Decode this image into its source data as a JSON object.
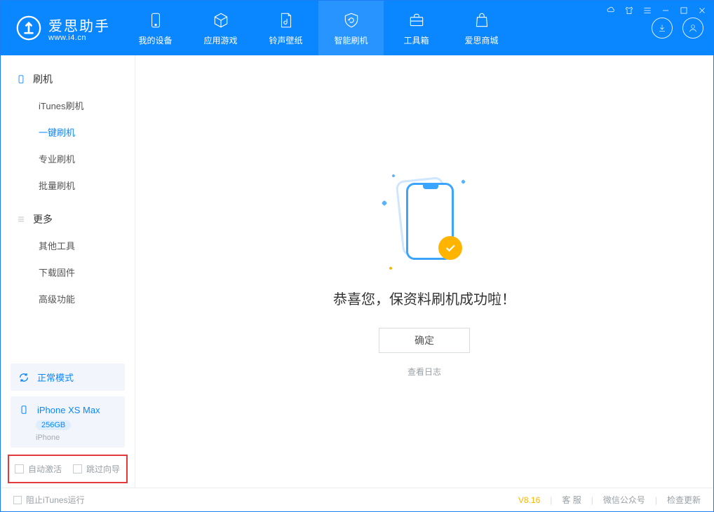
{
  "brand": {
    "cn": "爱思助手",
    "url": "www.i4.cn"
  },
  "tabs": {
    "device": "我的设备",
    "apps": "应用游戏",
    "ring": "铃声壁纸",
    "flash": "智能刷机",
    "tools": "工具箱",
    "store": "爱思商城"
  },
  "sidebar": {
    "group_flash": "刷机",
    "group_more": "更多",
    "items": {
      "itunes": "iTunes刷机",
      "onekey": "一键刷机",
      "pro": "专业刷机",
      "batch": "批量刷机",
      "other": "其他工具",
      "firmware": "下载固件",
      "advanced": "高级功能"
    }
  },
  "device": {
    "mode": "正常模式",
    "name": "iPhone XS Max",
    "storage": "256GB",
    "type": "iPhone"
  },
  "checks": {
    "auto_activate": "自动激活",
    "skip_wizard": "跳过向导"
  },
  "main": {
    "title": "恭喜您，保资料刷机成功啦！",
    "ok": "确定",
    "log": "查看日志"
  },
  "footer": {
    "stop_itunes": "阻止iTunes运行",
    "version": "V8.16",
    "support": "客 服",
    "wechat": "微信公众号",
    "update": "检查更新"
  }
}
